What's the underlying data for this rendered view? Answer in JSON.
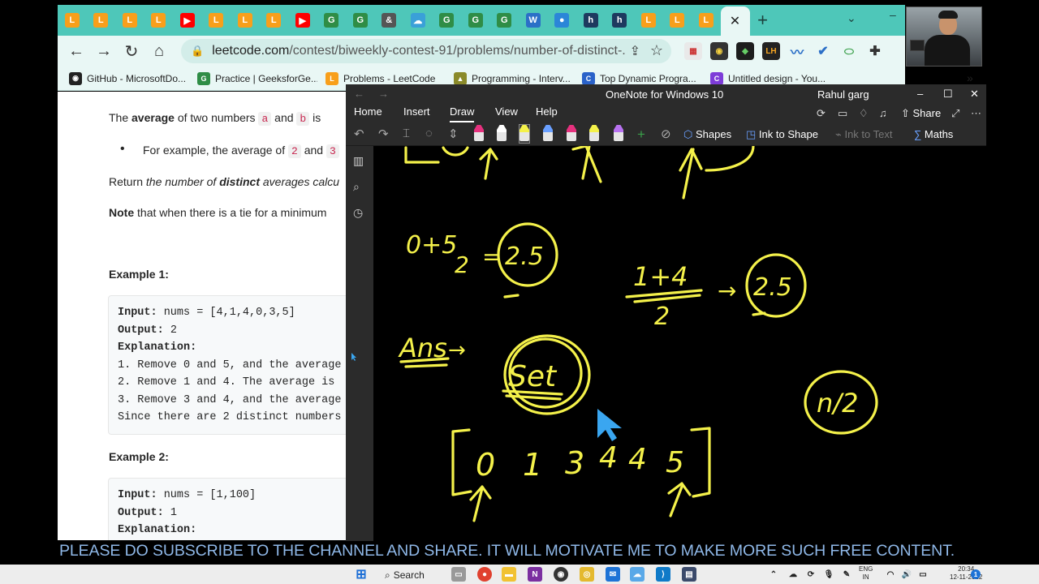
{
  "browser": {
    "url_host": "leetcode.com",
    "url_path": "/contest/biweekly-contest-91/problems/number-of-distinct-...",
    "active_tab_close": "✕",
    "new_tab": "+",
    "tabs": [
      {
        "icon": "leetcode-icon",
        "color": "#f89f1b",
        "glyph": "L"
      },
      {
        "icon": "leetcode-icon",
        "color": "#f89f1b",
        "glyph": "L"
      },
      {
        "icon": "leetcode-icon",
        "color": "#f89f1b",
        "glyph": "L"
      },
      {
        "icon": "leetcode-icon",
        "color": "#f89f1b",
        "glyph": "L"
      },
      {
        "icon": "youtube-icon",
        "color": "#ff0000",
        "glyph": "▶"
      },
      {
        "icon": "leetcode-icon",
        "color": "#f89f1b",
        "glyph": "L"
      },
      {
        "icon": "leetcode-icon",
        "color": "#f89f1b",
        "glyph": "L"
      },
      {
        "icon": "leetcode-icon",
        "color": "#f89f1b",
        "glyph": "L"
      },
      {
        "icon": "youtube-icon",
        "color": "#ff0000",
        "glyph": "▶"
      },
      {
        "icon": "geeksforgeeks-icon",
        "color": "#2f8d46",
        "glyph": "G"
      },
      {
        "icon": "geeksforgeeks-icon",
        "color": "#2f8d46",
        "glyph": "G"
      },
      {
        "icon": "ampersand-icon",
        "color": "#555555",
        "glyph": "&"
      },
      {
        "icon": "cloud-icon",
        "color": "#3aa0d8",
        "glyph": "☁"
      },
      {
        "icon": "geeksforgeeks-icon",
        "color": "#2f8d46",
        "glyph": "G"
      },
      {
        "icon": "geeksforgeeks-icon",
        "color": "#2f8d46",
        "glyph": "G"
      },
      {
        "icon": "geeksforgeeks-icon",
        "color": "#2f8d46",
        "glyph": "G"
      },
      {
        "icon": "word-icon",
        "color": "#2b6fc7",
        "glyph": "W"
      },
      {
        "icon": "circle-icon",
        "color": "#2b86d8",
        "glyph": "●"
      },
      {
        "icon": "h-icon",
        "color": "#1e3a5f",
        "glyph": "h"
      },
      {
        "icon": "h-icon",
        "color": "#1e3a5f",
        "glyph": "h"
      },
      {
        "icon": "leetcode-icon",
        "color": "#f89f1b",
        "glyph": "L"
      },
      {
        "icon": "leetcode-icon",
        "color": "#f89f1b",
        "glyph": "L"
      },
      {
        "icon": "leetcode-icon",
        "color": "#f89f1b",
        "glyph": "L"
      }
    ],
    "bookmarks": [
      {
        "label": "GitHub - MicrosoftDo...",
        "icon": "github-icon",
        "color": "#222222",
        "glyph": "◉"
      },
      {
        "label": "Practice | GeeksforGe...",
        "icon": "geeksforgeeks-icon",
        "color": "#2f8d46",
        "glyph": "G"
      },
      {
        "label": "Problems - LeetCode",
        "icon": "leetcode-icon",
        "color": "#f89f1b",
        "glyph": "L"
      },
      {
        "label": "Programming - Interv...",
        "icon": "interviewbit-icon",
        "color": "#8a8a2a",
        "glyph": "▲"
      },
      {
        "label": "Top Dynamic Progra...",
        "icon": "c-icon",
        "color": "#2a62c9",
        "glyph": "C"
      },
      {
        "label": "Untitled design - You...",
        "icon": "canva-icon",
        "color": "#7d3cd8",
        "glyph": "C"
      }
    ],
    "bookmarks_more": "»"
  },
  "problem": {
    "line_average_pre": "The ",
    "line_average_bold": "average",
    "line_average_mid": " of two numbers ",
    "var_a": "a",
    "and": " and ",
    "var_b": "b",
    "is": " is ",
    "bullet_text": "For example, the average of ",
    "num2": "2",
    "and2": " and ",
    "num3": "3",
    "return_pre": "Return ",
    "return_italic": "the number of ",
    "return_bold": "distinct",
    "return_rest": " averages calcu",
    "note_bold": "Note",
    "note_rest": " that when there is a tie for a minimum",
    "example1_title": "Example 1:",
    "example1_lines": [
      {
        "label": "Input:",
        "text": " nums = [4,1,4,0,3,5]"
      },
      {
        "label": "Output:",
        "text": " 2"
      },
      {
        "label": "Explanation:",
        "text": ""
      },
      {
        "label": "",
        "text": "1. Remove 0 and 5, and the average"
      },
      {
        "label": "",
        "text": "2. Remove 1 and 4. The average is"
      },
      {
        "label": "",
        "text": "3. Remove 3 and 4, and the average"
      },
      {
        "label": "",
        "text": "Since there are 2 distinct numbers"
      }
    ],
    "example2_title": "Example 2:",
    "example2_lines": [
      {
        "label": "Input:",
        "text": " nums = [1,100]"
      },
      {
        "label": "Output:",
        "text": " 1"
      },
      {
        "label": "Explanation:",
        "text": ""
      }
    ]
  },
  "onenote": {
    "title": "OneNote for Windows 10",
    "user": "Rahul garg",
    "menu": [
      "Home",
      "Insert",
      "Draw",
      "View",
      "Help"
    ],
    "share": "Share",
    "shapes": "Shapes",
    "ink_to_shape": "Ink to Shape",
    "ink_to_text": "Ink to Text",
    "maths": "Maths",
    "pens": [
      {
        "color": "#e6317e"
      },
      {
        "color": "#ffffff"
      },
      {
        "color": "#f4f14a"
      },
      {
        "color": "#6aa0ff"
      },
      {
        "color": "#e6317e"
      },
      {
        "color": "#f4f14a"
      },
      {
        "color": "#b872f0"
      }
    ],
    "ink_color": "#f4f14a",
    "ink_texts": {
      "frac_top_left": "0+5",
      "frac_bot_left": "2",
      "eq": "=",
      "val1": "2.5",
      "frac_top_right": "1+4",
      "frac_bot_right": "2",
      "arrow": "→",
      "val2": "2.5",
      "ans": "Ans",
      "ans_arrow": "→",
      "set": "Set",
      "n_half": "n/2",
      "array": [
        "0",
        "1",
        "3",
        "4",
        "4",
        "5"
      ]
    }
  },
  "caption": "PLEASE DO SUBSCRIBE TO THE CHANNEL AND SHARE. IT WILL MOTIVATE ME TO MAKE MORE SUCH FREE CONTENT.",
  "taskbar": {
    "search": "Search",
    "lang_top": "ENG",
    "lang_bot": "IN",
    "time": "20:34",
    "date": "12-11-2022"
  }
}
